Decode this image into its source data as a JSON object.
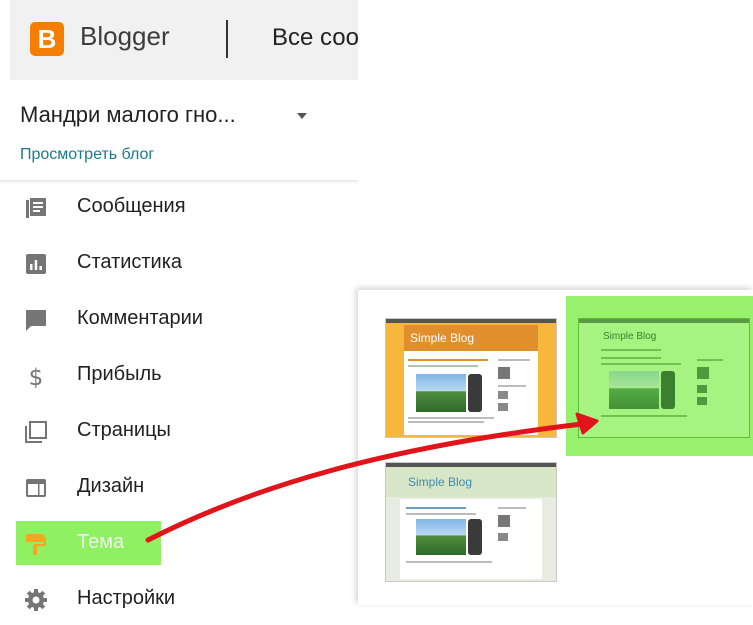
{
  "app": {
    "name": "Blogger",
    "logo_letter": "B",
    "breadcrumb": "Все сообщения"
  },
  "blog": {
    "name": "Мандри малого гно...",
    "view_link": "Просмотреть блог"
  },
  "nav": {
    "items": [
      {
        "label": "Сообщения",
        "icon": "posts-icon"
      },
      {
        "label": "Статистика",
        "icon": "stats-icon"
      },
      {
        "label": "Комментарии",
        "icon": "comments-icon"
      },
      {
        "label": "Прибыль",
        "icon": "dollar-icon"
      },
      {
        "label": "Страницы",
        "icon": "pages-icon"
      },
      {
        "label": "Дизайн",
        "icon": "layout-icon"
      },
      {
        "label": "Тема",
        "icon": "paint-roller-icon"
      },
      {
        "label": "Настройки",
        "icon": "gear-icon"
      }
    ]
  },
  "themes": {
    "cards": [
      {
        "title": "Simple Blog",
        "variant": "orange"
      },
      {
        "title": "Simple Blog",
        "variant": "green-highlighted"
      },
      {
        "title": "Simple Blog",
        "variant": "light-green"
      }
    ]
  },
  "colors": {
    "brand": "#f57d00",
    "link": "#1a7a8c",
    "highlight": "#8ff061",
    "arrow": "#e0141a"
  }
}
